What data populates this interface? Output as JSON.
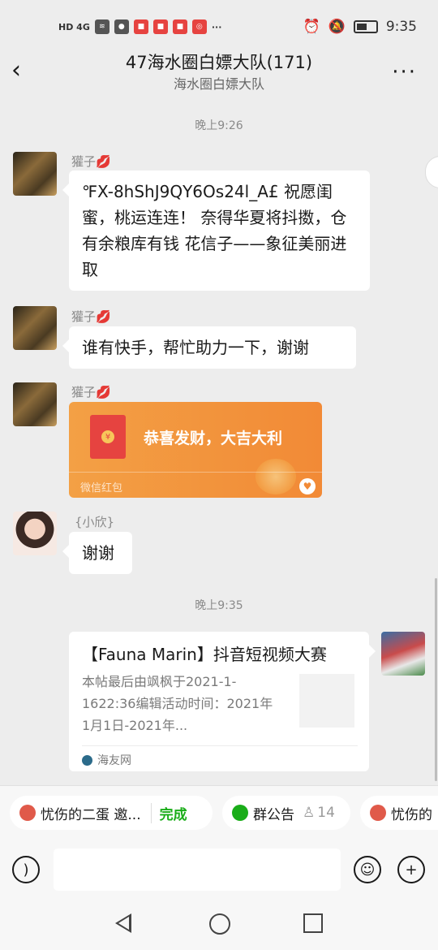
{
  "status_bar": {
    "left_text": "HD 4G",
    "time": "9:35"
  },
  "header": {
    "title": "47海水圈白嫖大队(171)",
    "subtitle": "海水圈白嫖大队",
    "more": "···"
  },
  "messages": {
    "time1": "晚上9:26",
    "m1": {
      "nick": "獾子💋",
      "text": "℉X-8hShJ9QY6Os24l_A£ 祝愿闺蜜，桃运连连！ 奈得华夏将抖擞，仓有余粮库有钱 花信子——象征美丽进取"
    },
    "m2": {
      "nick": "獾子💋",
      "text": "谁有快手，帮忙助力一下，谢谢"
    },
    "m3": {
      "nick": "獾子💋",
      "greeting": "恭喜发财，大吉大利",
      "label": "微信红包",
      "coin": "¥"
    },
    "m4": {
      "nick": "{小欣}",
      "text": "谢谢"
    },
    "time2": "晚上9:35",
    "m5": {
      "title": "【Fauna Marin】抖音短视频大赛",
      "desc": "本帖最后由飒枫于2021-1-1622:36编辑活动时间：2021年1月1日-2021年...",
      "source": "海友网"
    }
  },
  "chips": [
    {
      "label": "忧伤的二蛋 邀...",
      "action": "完成"
    },
    {
      "label": "群公告",
      "count": "14"
    },
    {
      "label": "忧伤的"
    }
  ],
  "input": {
    "placeholder": ""
  }
}
